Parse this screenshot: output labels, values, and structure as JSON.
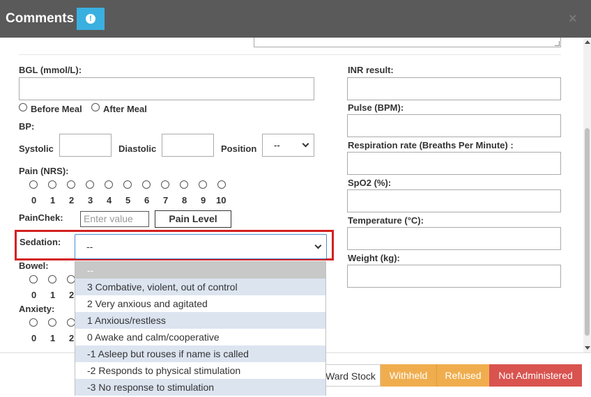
{
  "header": {
    "title": "Comments",
    "alert_glyph": "!",
    "close_glyph": "×"
  },
  "form": {
    "bgl_label": "BGL (mmol/L):",
    "meal_options": [
      "Before Meal",
      "After Meal"
    ],
    "bp_label": "BP:",
    "systolic_label": "Systolic",
    "diastolic_label": "Diastolic",
    "position_label": "Position",
    "position_value": "--",
    "pain_label": "Pain (NRS):",
    "pain_scale": [
      "0",
      "1",
      "2",
      "3",
      "4",
      "5",
      "6",
      "7",
      "8",
      "9",
      "10"
    ],
    "painchek_label": "PainChek:",
    "painchek_placeholder": "Enter value",
    "pain_level_button": "Pain Level",
    "sedation_label": "Sedation:",
    "sedation_value": "--",
    "bowel_label": "Bowel:",
    "bowel_scale": [
      "0",
      "1",
      "2"
    ],
    "anxiety_label": "Anxiety:",
    "anxiety_scale": [
      "0",
      "1",
      "2"
    ],
    "inr_label": "INR result:",
    "pulse_label": "Pulse (BPM):",
    "respiration_label": "Respiration rate (Breaths Per Minute) :",
    "spo2_label": "SpO2 (%):",
    "temperature_label": "Temperature (°C):",
    "weight_label": "Weight (kg):"
  },
  "sedation_options": [
    "--",
    "3 Combative, violent, out of control",
    "2 Very anxious and agitated",
    "1 Anxious/restless",
    "0 Awake and calm/cooperative",
    "-1 Asleep but rouses if name is called",
    "-2 Responds to physical stimulation",
    "-3 No response to stimulation"
  ],
  "footer": {
    "ward_stock": "Ward Stock",
    "withheld": "Withheld",
    "refused": "Refused",
    "not_administered": "Not Administered"
  },
  "colors": {
    "header_bg": "#5a5a5a",
    "alert": "#3ab0e0",
    "warning": "#f0ad4e",
    "danger": "#d9534f",
    "highlight": "#d42020"
  }
}
